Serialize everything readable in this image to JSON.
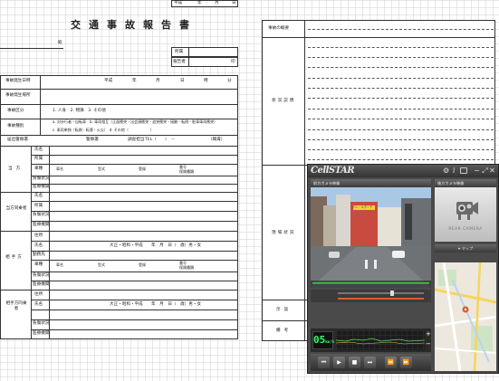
{
  "header": {
    "date_era": "平成",
    "year": "年",
    "month": "月",
    "day": "日",
    "title": "交通事故報告書",
    "recipient_suffix": "殿",
    "company_label": "所属",
    "reporter_label": "報告者",
    "seal": "印"
  },
  "left_rows": {
    "occurrence_date": "事故発生日時",
    "date_era": "平成",
    "date_parts": [
      "年",
      "月",
      "日",
      "時",
      "分"
    ],
    "occurrence_place": "事故発生場所",
    "category": "事故区分",
    "category_options": "1. 人身　2. 物損　3. その他",
    "type": "事故種別",
    "type_options_1": "a. 対歩行者・自転車　b. 車両相互（正面衝突・出会頭衝突・追突衝突・接触・転倒・駐車車両衝突）",
    "type_options_2": "c. 車両単独（転倒・転落・火災）　d. その他（　　　　　　）",
    "police": "届出警察署",
    "police_station": "警察署",
    "police_officer": "調査担当",
    "police_tel": "TEL（　　）　－",
    "police_extension": "（職責）"
  },
  "party_self": {
    "label": "当方",
    "fields": [
      "氏名",
      "所属",
      "車種",
      "負傷状況",
      "医療機関"
    ],
    "vehicle_cols": [
      "車名",
      "型式",
      "登録",
      "番号",
      "保険種類"
    ]
  },
  "party_self_passenger": {
    "label": "当方同乗者",
    "fields": [
      "氏名",
      "所属",
      "負傷状況",
      "医療機関"
    ]
  },
  "party_other": {
    "label": "相手方",
    "fields": [
      "住所",
      "氏名",
      "勤務先",
      "車種",
      "負傷状況",
      "医療機関"
    ],
    "birth": "大正・昭和・平成　　年　月　日（　歳）男・女",
    "vehicle_cols": [
      "車名",
      "型式",
      "登録",
      "番号",
      "保険種類"
    ]
  },
  "party_other_passenger": {
    "label": "相手方同乗者",
    "fields": [
      "住所",
      "氏名",
      "負傷状況",
      "医療機関"
    ],
    "birth": "大正・昭和・平成　　年　月　日（　歳）男・女"
  },
  "right_sections": {
    "summary": "事故の概要",
    "situation": "状況説明",
    "site_diagram": "現場状況",
    "damage": "示談",
    "remarks": "備考"
  },
  "app": {
    "logo": "CellSTAR",
    "front_camera": "前方カメラ映像",
    "rear_camera": "後方カメラ映像",
    "rear_placeholder": "REAR CAMERA",
    "map_button": "マップ",
    "speed_value": "05",
    "speed_unit": "km/h",
    "window_buttons": [
      "−",
      "⤢",
      "✕"
    ],
    "player_buttons": [
      "⏮",
      "▶",
      "■",
      "⏭",
      "⏪",
      "⏩"
    ],
    "video_signs": [
      "ドン・キホーテ"
    ],
    "colors": {
      "frame": "#4a4a4a",
      "speed": "#33ff66",
      "accent": "#e05a2b"
    }
  }
}
